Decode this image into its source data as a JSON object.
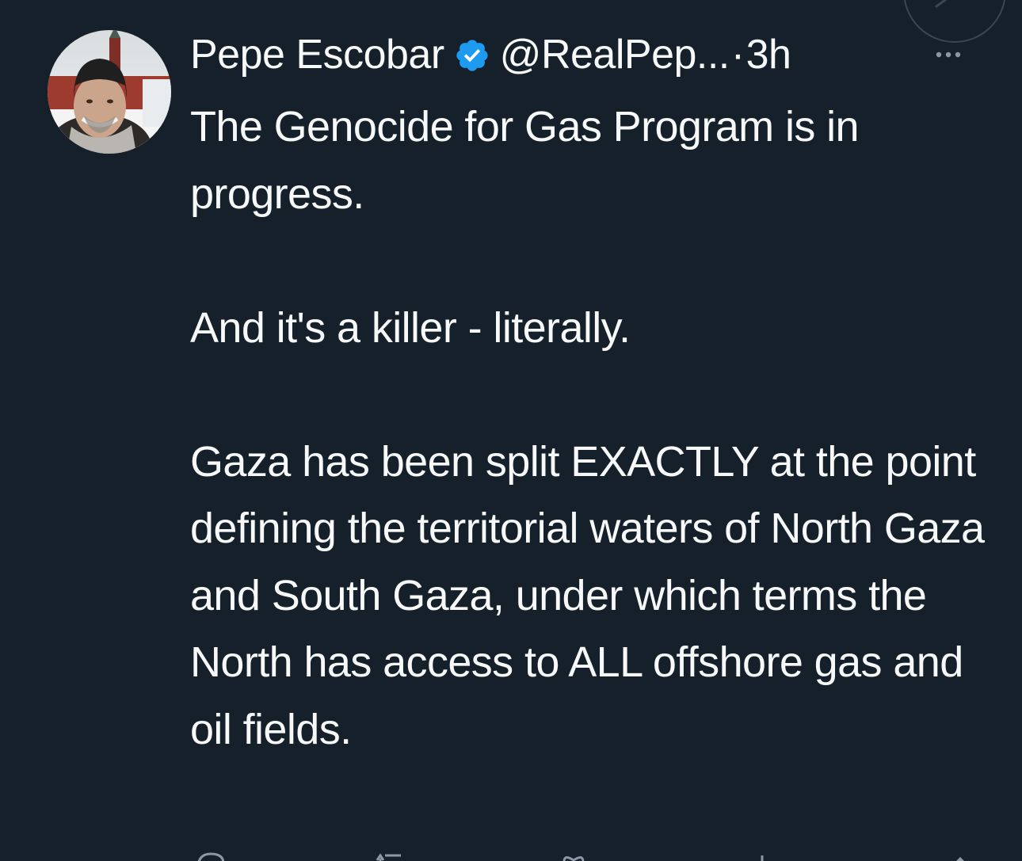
{
  "tweet": {
    "author": {
      "display_name": "Pepe Escobar",
      "handle": "@RealPep...",
      "verified": true
    },
    "separator": "·",
    "time": "3h",
    "more_label": "···",
    "body": [
      "The Genocide for Gas Program is in progress.",
      "And it's a killer - literally.",
      "Gaza has been split EXACTLY at the point defining the territorial waters of North Gaza and South Gaza, under which terms the North has access to ALL offshore gas and oil fields."
    ]
  },
  "colors": {
    "background": "#15202b",
    "text": "#f7f9f9",
    "verified_badge": "#1d9bf0",
    "secondary": "#8b98a5"
  },
  "icons": [
    "verified-badge-icon",
    "more-options-icon",
    "reply-icon",
    "retweet-icon",
    "like-icon",
    "views-icon",
    "share-icon"
  ]
}
